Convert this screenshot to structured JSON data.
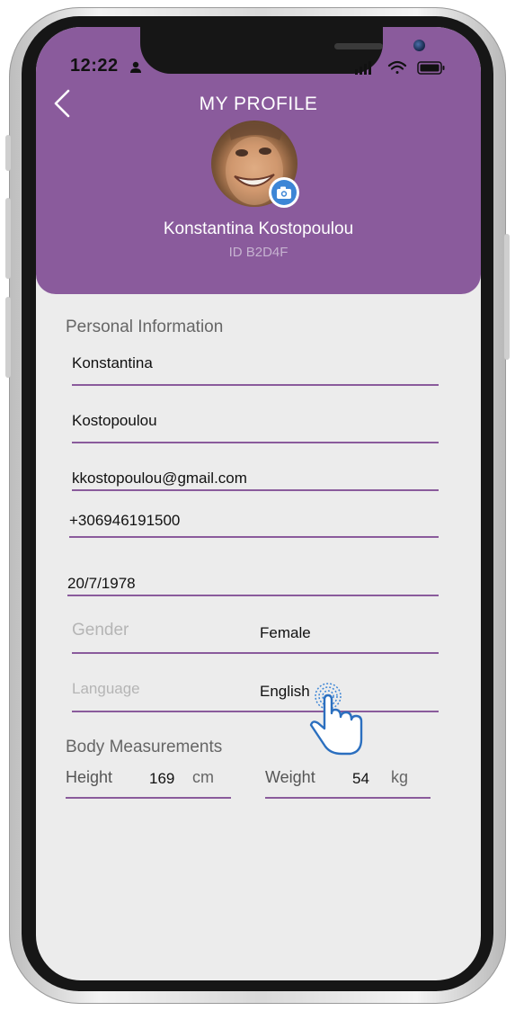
{
  "status_bar": {
    "time": "12:22"
  },
  "header": {
    "title": "MY PROFILE",
    "user_name": "Konstantina Kostopoulou",
    "user_id": "ID B2D4F"
  },
  "personal": {
    "section_label": "Personal Information",
    "first_name": "Konstantina",
    "last_name": "Kostopoulou",
    "email": "kkostopoulou@gmail.com",
    "phone": "+306946191500",
    "birth_date": "20/7/1978",
    "gender_label": "Gender",
    "gender_value": "Female",
    "language_label": "Language",
    "language_value": "English"
  },
  "body": {
    "section_label": "Body Measurements",
    "height_label": "Height",
    "height_value": "169",
    "height_unit": "cm",
    "weight_label": "Weight",
    "weight_value": "54",
    "weight_unit": "kg"
  },
  "colors": {
    "accent": "#8a5b9c",
    "camera_badge": "#3d86d6"
  },
  "icons": [
    "back-chevron-icon",
    "person-icon",
    "signal-icon",
    "wifi-icon",
    "battery-icon",
    "camera-icon",
    "tap-hand-icon"
  ]
}
